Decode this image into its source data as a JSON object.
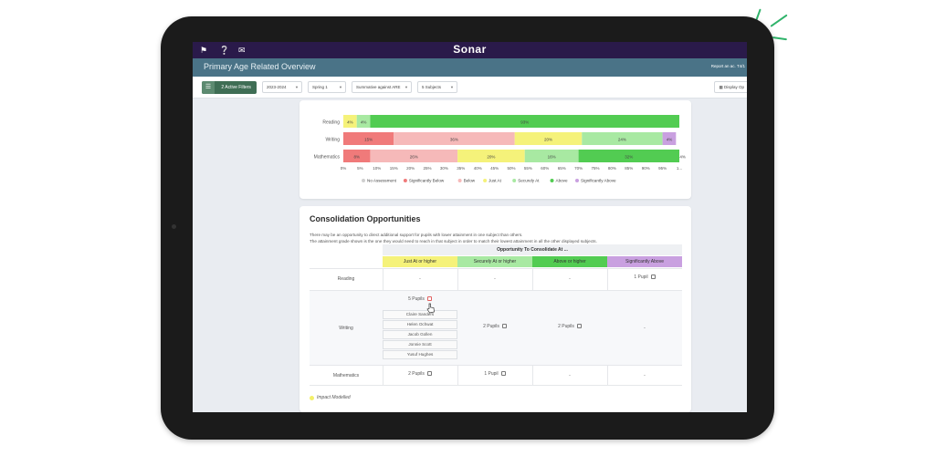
{
  "app": {
    "brand": "Sonar",
    "page_title": "Primary Age Related Overview",
    "report_label": "Report an ac. T4/1"
  },
  "filters": {
    "active_filters_label": "2 Active Filters",
    "year": "2023-2024",
    "term": "Spring 1",
    "comparison": "Summative against ARE",
    "subjects": "5 Subjects",
    "display_label": "Display Op"
  },
  "colors": {
    "topbar": "#2a1a4a",
    "titlebar": "#4a7387",
    "no_assessment": "#e0e0e0",
    "significantly_below": "#f07a7a",
    "below": "#f6b9b9",
    "just_at": "#f5f27a",
    "securely_at": "#a8e9a2",
    "above": "#52cc52",
    "significantly_above": "#c9a0e0"
  },
  "chart_data": {
    "type": "bar",
    "stacked": "horizontal-100",
    "categories": [
      "Reading",
      "Writing",
      "Mathematics"
    ],
    "series": [
      {
        "name": "Significantly Below",
        "values": [
          0,
          15,
          8
        ]
      },
      {
        "name": "Below",
        "values": [
          0,
          36,
          26
        ]
      },
      {
        "name": "Just At",
        "values": [
          4,
          20,
          20
        ]
      },
      {
        "name": "Securely At",
        "values": [
          4,
          24,
          16
        ]
      },
      {
        "name": "Above",
        "values": [
          93,
          0,
          32
        ]
      },
      {
        "name": "Significantly Above",
        "values": [
          0,
          4,
          4
        ]
      }
    ],
    "segment_labels": [
      [
        "4%",
        "4%",
        "93%"
      ],
      [
        "15%",
        "36%",
        "20%",
        "24%",
        "4%"
      ],
      [
        "8%",
        "26%",
        "20%",
        "16%",
        "32%",
        "4%"
      ]
    ],
    "x_ticks": [
      "0%",
      "5%",
      "10%",
      "15%",
      "20%",
      "25%",
      "30%",
      "35%",
      "40%",
      "45%",
      "50%",
      "55%",
      "60%",
      "65%",
      "70%",
      "75%",
      "80%",
      "85%",
      "90%",
      "95%",
      "1..."
    ],
    "xlim": [
      0,
      100
    ],
    "legend": [
      "No Assessment",
      "Significantly Below",
      "Below",
      "Just At",
      "Securely At",
      "Above",
      "Significantly Above"
    ],
    "legend_position": "bottom"
  },
  "consolidation": {
    "title": "Consolidation Opportunities",
    "desc_line1": "There may be an opportunity to direct additional support for pupils with lower attainment in one subject than others.",
    "desc_line2": "The attainment grade shown is the one they would need to reach in that subject in order to match their lowest attainment in all the other displayed subjects.",
    "group_header": "Opportunity To Consolidate At ...",
    "columns": [
      "Just At or higher",
      "Securely At or higher",
      "Above or higher",
      "Significantly Above"
    ],
    "rows": [
      {
        "subject": "Reading",
        "cells": [
          "-",
          "-",
          "-",
          "1 Pupil"
        ]
      },
      {
        "subject": "Writing",
        "cells": [
          "5 Pupils",
          "2 Pupils",
          "2 Pupils",
          "-"
        ]
      },
      {
        "subject": "Mathematics",
        "cells": [
          "2 Pupils",
          "1 Pupil",
          "-",
          "-"
        ]
      }
    ],
    "expanded_pupils": [
      "Claire Sanders",
      "Helen Ochwat",
      "Jacob Gollen",
      "Jonnie Scott",
      "Yusuf Hughes"
    ],
    "impact_label": "Impact Modelled"
  }
}
